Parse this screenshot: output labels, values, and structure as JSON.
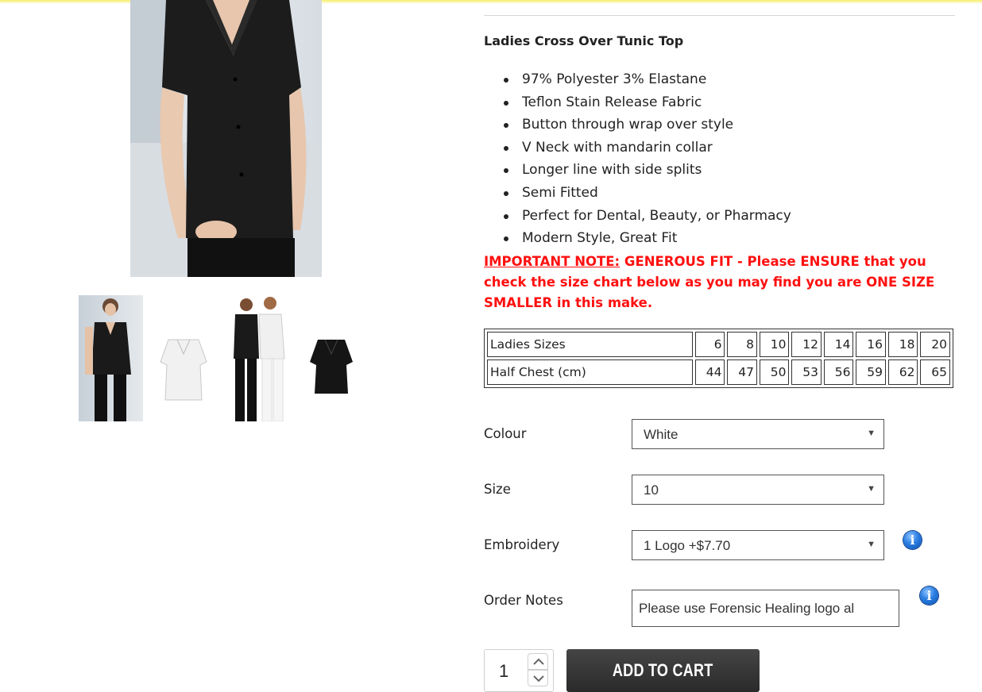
{
  "product": {
    "title": "Ladies Cross Over Tunic Top",
    "features": [
      "97% Polyester 3% Elastane",
      "Teflon Stain Release Fabric",
      "Button through wrap over style",
      "V Neck with mandarin collar",
      "Longer line with side splits",
      "Semi Fitted",
      "Perfect for Dental, Beauty, or Pharmacy",
      "Modern Style, Great Fit"
    ],
    "note_label": "IMPORTANT NOTE:",
    "note_text": " GENEROUS FIT - Please ENSURE that you check the size chart below as you may find you are ONE SIZE SMALLER in this make."
  },
  "gallery": {
    "thumbnails": [
      "Black tunic on model",
      "White tunic",
      "Two models in tunics",
      "Black tunic"
    ]
  },
  "size_chart": {
    "rows": [
      {
        "label": "Ladies Sizes",
        "values": [
          "6",
          "8",
          "10",
          "12",
          "14",
          "16",
          "18",
          "20"
        ]
      },
      {
        "label": "Half Chest (cm)",
        "values": [
          "44",
          "47",
          "50",
          "53",
          "56",
          "59",
          "62",
          "65"
        ]
      }
    ]
  },
  "options": {
    "colour": {
      "label": "Colour",
      "value": "White"
    },
    "size": {
      "label": "Size",
      "value": "10"
    },
    "embroidery": {
      "label": "Embroidery",
      "value": "1 Logo +$7.70"
    },
    "order_notes": {
      "label": "Order Notes",
      "value": "Please use Forensic Healing logo al"
    }
  },
  "cart": {
    "quantity": "1",
    "add_label": "ADD TO CART"
  },
  "colors": {
    "note": "#ff1010",
    "button": "#333333",
    "info_icon": "#2a7de1"
  },
  "icons": [
    "info-icon",
    "chevron-up-icon",
    "chevron-down-icon",
    "dropdown-arrow-icon"
  ]
}
